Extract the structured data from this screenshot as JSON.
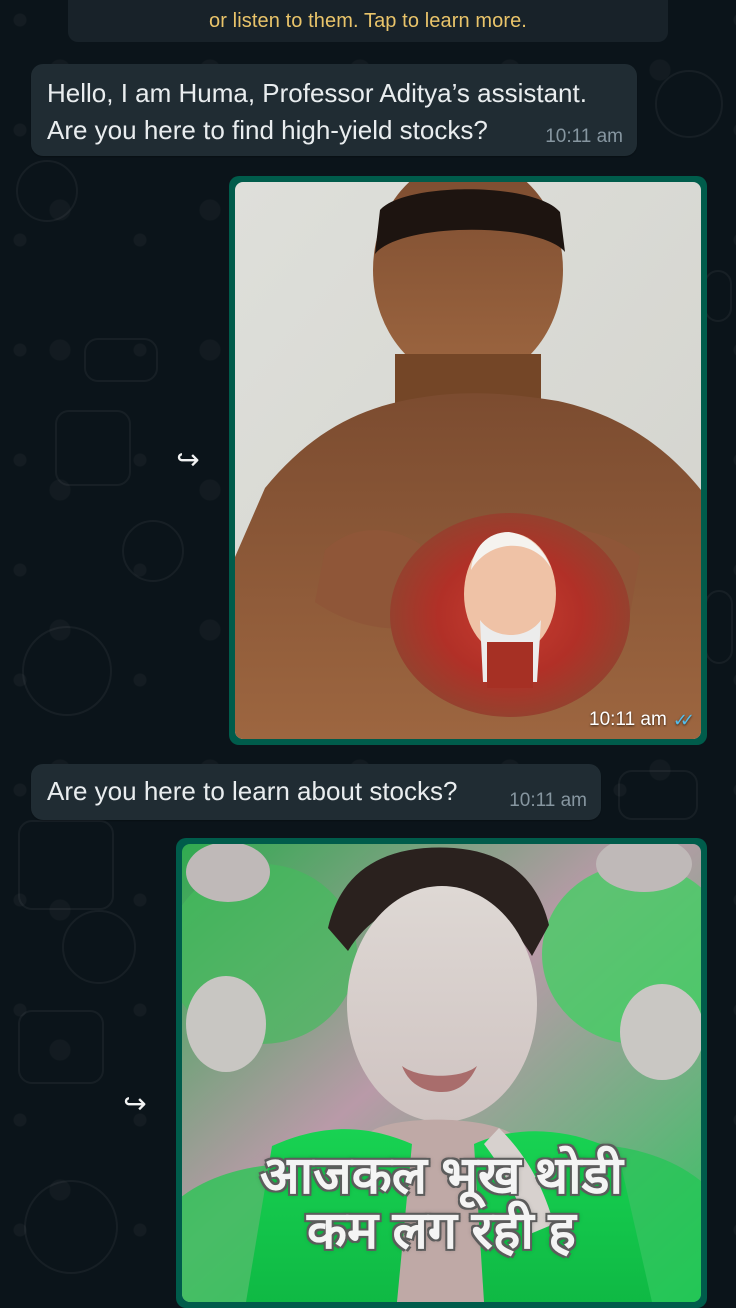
{
  "notice": {
    "text": "or listen to them. Tap to learn more."
  },
  "messages": [
    {
      "type": "incoming",
      "text_line1": "Hello, I am Huma, Professor Aditya’s assistant.",
      "text_line2": "Are you here to find high-yield stocks?",
      "time": "10:11 am"
    },
    {
      "type": "outgoing-image",
      "time": "10:11 am",
      "icon": "double-check-icon"
    },
    {
      "type": "incoming",
      "text": "Are you here to learn about stocks?",
      "time": "10:11 am"
    },
    {
      "type": "outgoing-image",
      "caption_line1": "आजकल भूख थोडी",
      "caption_line2": "कम लग रही ह"
    }
  ],
  "colors": {
    "app_bg": "#0b141a",
    "incoming_bubble": "#202c33",
    "outgoing_bubble": "#005c4b",
    "notice_text": "#e9c46a",
    "read_tick": "#53bdeb"
  },
  "icons": {
    "forward_1": "forward-icon",
    "forward_2": "forward-icon"
  }
}
